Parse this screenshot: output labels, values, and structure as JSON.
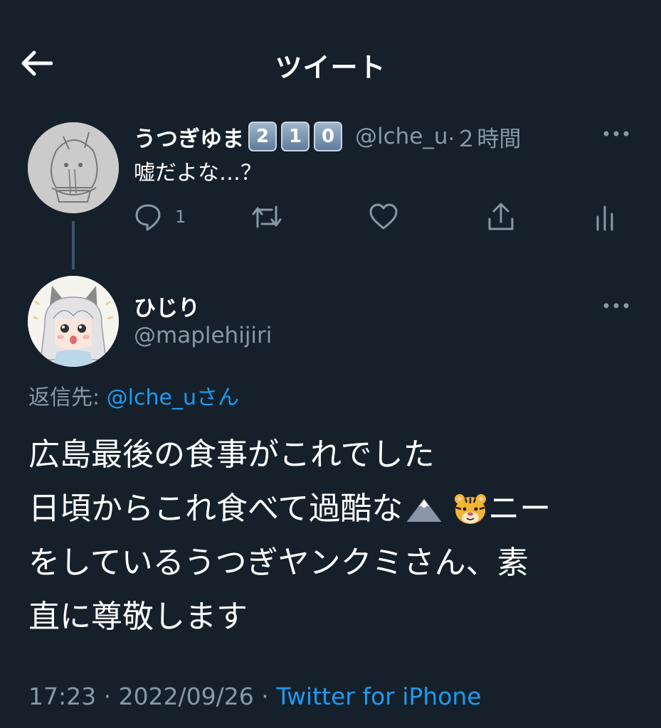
{
  "header": {
    "title": "ツイート"
  },
  "parent_tweet": {
    "name": "うつぎゆま",
    "badges": [
      "2",
      "1",
      "0"
    ],
    "handle": "@lche_u",
    "time": "·２時間",
    "text": "嘘だよな…？",
    "reply_count": "1",
    "icons": [
      "reply-icon",
      "retweet-icon",
      "like-icon",
      "share-icon",
      "analytics-icon"
    ]
  },
  "main_tweet": {
    "name": "ひじり",
    "handle": "@maplehijiri",
    "reply_prefix": "返信先: ",
    "reply_target": "@lche_u",
    "reply_suffix": "さん",
    "line1": "広島最後の食事がこれでした",
    "line2_before": "日頃からこれ食べて過酷な",
    "line2_after": " ニー",
    "line2_emojis": [
      "mountain-emoji",
      "tiger-emoji"
    ],
    "line3": "をしているうつぎヤンクミさん、素",
    "line4": "直に尊敬します",
    "timestamp": "17:23 · 2022/09/26 · ",
    "source": "Twitter for iPhone"
  },
  "colors": {
    "background": "#15202b",
    "secondary_text": "#8899a6",
    "link": "#1d9bf0"
  }
}
